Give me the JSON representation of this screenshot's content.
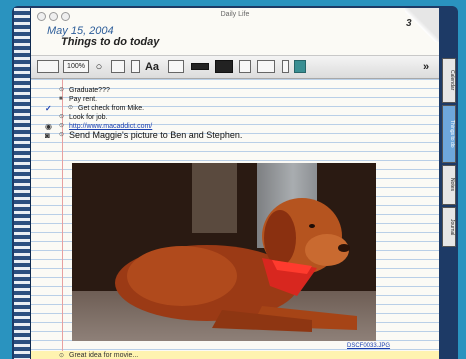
{
  "window": {
    "title": "Daily Life"
  },
  "page": {
    "date": "May 15, 2004",
    "title": "Things to do today",
    "page_number": "3"
  },
  "toolbar": {
    "zoom": "100%",
    "font_label": "Aa",
    "more_label": "»"
  },
  "items": [
    {
      "text": "Graduate???",
      "marker": "",
      "link": false
    },
    {
      "text": "Pay rent.",
      "marker": "",
      "link": false
    },
    {
      "text": "Get check from Mike.",
      "marker": "✓",
      "link": false
    },
    {
      "text": "Look for job.",
      "marker": "",
      "link": false
    },
    {
      "text": "http://www.macaddict.com/",
      "marker": "",
      "link": true
    },
    {
      "text": "Send Maggie's picture to Ben and Stephen.",
      "marker": "",
      "link": false
    }
  ],
  "attachment": {
    "filename": "DSCF0033.JPG"
  },
  "bottom_note": "Great idea for movie...",
  "side_tabs": [
    "Calendar",
    "Things to do",
    "Notes",
    "Journal"
  ]
}
